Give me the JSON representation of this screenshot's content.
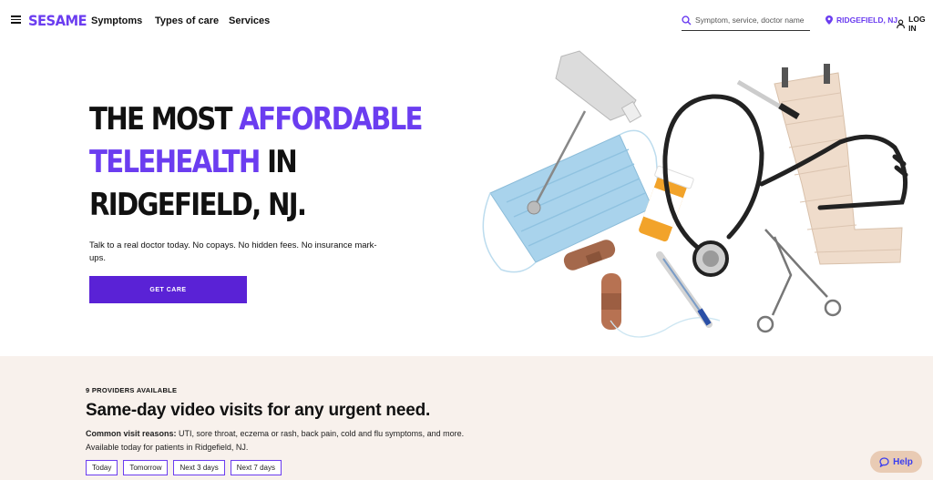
{
  "brand": {
    "logo_text": "SESAME",
    "accent_color": "#6b3df0",
    "button_color": "#5a22d6"
  },
  "nav": {
    "items": [
      "Symptoms",
      "Types of care",
      "Services"
    ],
    "search_placeholder": "Symptom, service, doctor name",
    "location": "RIDGEFIELD, NJ",
    "login": "LOG IN"
  },
  "hero": {
    "line1_a": "THE MOST ",
    "line1_b": "AFFORDABLE",
    "line2_a": "TELEHEALTH",
    "line2_b": " IN",
    "line3": "RIDGEFIELD, NJ.",
    "subtitle": "Talk to a real doctor today. No copays. No hidden fees. No insurance mark-ups.",
    "cta_label": "GET CARE"
  },
  "bottom": {
    "providers": "9 PROVIDERS AVAILABLE",
    "heading": "Same-day video visits for any urgent need.",
    "reasons_label": "Common visit reasons:",
    "reasons_text": " UTI, sore throat, eczema or rash, back pain, cold and flu symptoms, and more. Available today for patients in Ridgefield, NJ.",
    "date_tabs": [
      "Today",
      "Tomorrow",
      "Next 3 days",
      "Next 7 days"
    ]
  },
  "help": {
    "label": "Help",
    "background": "#e9cbb4"
  }
}
